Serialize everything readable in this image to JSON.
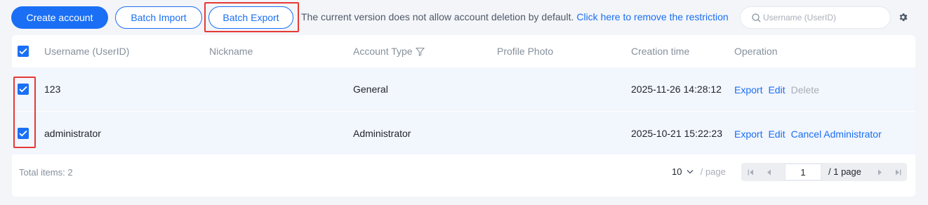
{
  "toolbar": {
    "create_label": "Create account",
    "import_label": "Batch Import",
    "export_label": "Batch Export",
    "notice_text": "The current version does not allow account deletion by default.",
    "notice_link": "Click here to remove the restriction",
    "search_placeholder": "Username (UserID)",
    "icons": {
      "search": "search-icon",
      "settings": "gear-icon"
    }
  },
  "table": {
    "columns": [
      "Username (UserID)",
      "Nickname",
      "Account Type",
      "Profile Photo",
      "Creation time",
      "Operation"
    ],
    "rows": [
      {
        "username": "123",
        "nickname": "",
        "account_type": "General",
        "profile_photo": "",
        "creation_time": "2025-11-26 14:28:12",
        "ops": [
          "Export",
          "Edit",
          "Delete"
        ],
        "checked": true
      },
      {
        "username": "administrator",
        "nickname": "",
        "account_type": "Administrator",
        "profile_photo": "",
        "creation_time": "2025-10-21 15:22:23",
        "ops": [
          "Export",
          "Edit",
          "Cancel Administrator"
        ],
        "checked": true
      }
    ],
    "header_checked": true
  },
  "footer": {
    "total_label": "Total items:",
    "total_value": "2",
    "page_size": "10",
    "page_size_unit": "/ page",
    "current_page": "1",
    "page_total": "/ 1 page"
  },
  "colors": {
    "accent": "#1a6ff5",
    "highlight": "#e53935",
    "row_bg": "#f2f6fd",
    "muted": "#86909c"
  }
}
